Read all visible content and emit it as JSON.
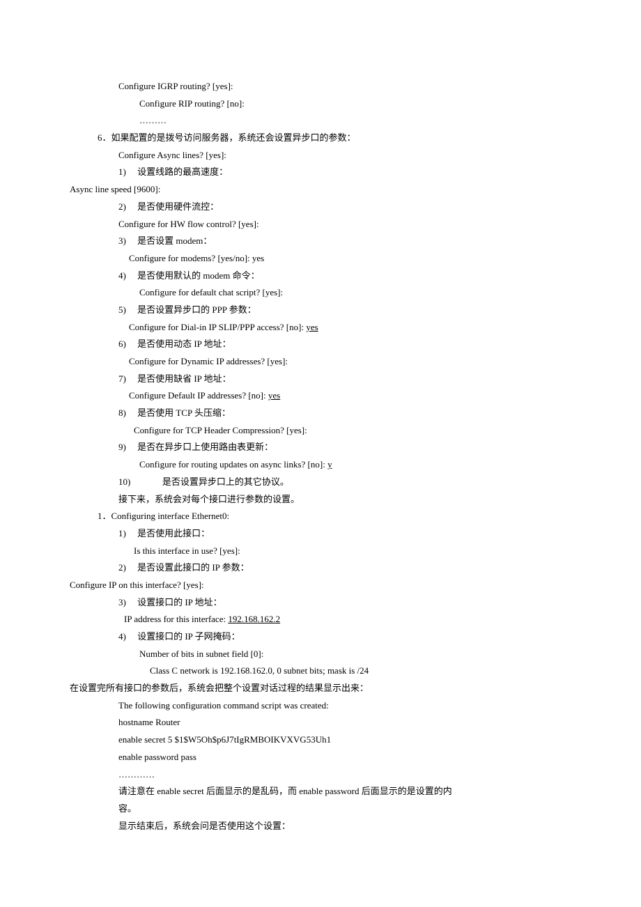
{
  "lines": [
    {
      "indent": 70,
      "text": "Configure IGRP routing? [yes]:"
    },
    {
      "indent": 100,
      "text": "Configure RIP routing? [no]:"
    },
    {
      "indent": 100,
      "text": "………"
    },
    {
      "indent": 40,
      "text": "6．如果配置的是拨号访问服务器，系统还会设置异步口的参数："
    },
    {
      "indent": 70,
      "text": "Configure Async lines? [yes]:"
    },
    {
      "indent": 70,
      "parts": [
        {
          "t": "1)"
        },
        {
          "pad": "     "
        },
        {
          "t": "设置线路的最高速度："
        }
      ]
    },
    {
      "indent": -70,
      "text": "Async line speed [9600]:"
    },
    {
      "indent": 70,
      "parts": [
        {
          "t": "2)"
        },
        {
          "pad": "     "
        },
        {
          "t": "是否使用硬件流控："
        }
      ]
    },
    {
      "indent": 70,
      "text": "Configure for HW flow control? [yes]:"
    },
    {
      "indent": 70,
      "parts": [
        {
          "t": "3)"
        },
        {
          "pad": "     "
        },
        {
          "t": "是否设置 modem："
        }
      ]
    },
    {
      "indent": 85,
      "text": "Configure for modems? [yes/no]: yes"
    },
    {
      "indent": 70,
      "parts": [
        {
          "t": "4)"
        },
        {
          "pad": "     "
        },
        {
          "t": "是否使用默认的 modem 命令："
        }
      ]
    },
    {
      "indent": 100,
      "text": "Configure for default chat script? [yes]:"
    },
    {
      "indent": 70,
      "parts": [
        {
          "t": "5)"
        },
        {
          "pad": "     "
        },
        {
          "t": "是否设置异步口的 PPP 参数："
        }
      ]
    },
    {
      "indent": 85,
      "parts": [
        {
          "t": "Configure for Dial-in IP SLIP/PPP access? [no]: "
        },
        {
          "t": "yes",
          "u": true
        }
      ]
    },
    {
      "indent": 70,
      "parts": [
        {
          "t": "6)"
        },
        {
          "pad": "     "
        },
        {
          "t": "是否使用动态 IP 地址："
        }
      ]
    },
    {
      "indent": 85,
      "text": "Configure for Dynamic IP addresses? [yes]:"
    },
    {
      "indent": 70,
      "parts": [
        {
          "t": "7)"
        },
        {
          "pad": "     "
        },
        {
          "t": "是否使用缺省 IP 地址："
        }
      ]
    },
    {
      "indent": 85,
      "parts": [
        {
          "t": "Configure Default IP addresses? [no]: "
        },
        {
          "t": "yes",
          "u": true
        }
      ]
    },
    {
      "indent": 70,
      "parts": [
        {
          "t": "8)"
        },
        {
          "pad": "     "
        },
        {
          "t": "是否使用 TCP 头压缩："
        }
      ]
    },
    {
      "indent": 92,
      "text": "Configure for TCP Header Compression? [yes]:"
    },
    {
      "indent": 70,
      "parts": [
        {
          "t": "9)"
        },
        {
          "pad": "     "
        },
        {
          "t": "是否在异步口上使用路由表更新："
        }
      ]
    },
    {
      "indent": 100,
      "parts": [
        {
          "t": "Configure for routing updates on async links? [no]: "
        },
        {
          "t": "y",
          "u": true
        }
      ]
    },
    {
      "indent": 70,
      "parts": [
        {
          "t": "10)"
        },
        {
          "pad": "              "
        },
        {
          "t": "是否设置异步口上的其它协议。"
        }
      ]
    },
    {
      "indent": 70,
      "text": "接下来，系统会对每个接口进行参数的设置。"
    },
    {
      "indent": 40,
      "text": "1．Configuring interface Ethernet0:"
    },
    {
      "indent": 70,
      "parts": [
        {
          "t": "1)"
        },
        {
          "pad": "     "
        },
        {
          "t": "是否使用此接口："
        }
      ]
    },
    {
      "indent": 92,
      "text": "Is this interface in use? [yes]:"
    },
    {
      "indent": 70,
      "parts": [
        {
          "t": "2)"
        },
        {
          "pad": "     "
        },
        {
          "t": "是否设置此接口的 IP 参数："
        }
      ]
    },
    {
      "indent": -38,
      "text": "Configure IP on this interface? [yes]:"
    },
    {
      "indent": 70,
      "parts": [
        {
          "t": "3)"
        },
        {
          "pad": "     "
        },
        {
          "t": "设置接口的 IP 地址："
        }
      ]
    },
    {
      "indent": 78,
      "parts": [
        {
          "t": "IP address for this interface: "
        },
        {
          "t": "192.168.162.2",
          "u": true
        }
      ]
    },
    {
      "indent": 70,
      "parts": [
        {
          "t": "4)"
        },
        {
          "pad": "     "
        },
        {
          "t": "设置接口的 IP 子网掩码："
        }
      ]
    },
    {
      "indent": 100,
      "text": "Number of bits in subnet field [0]:"
    },
    {
      "indent": 115,
      "text": "Class C network is 192.168.162.0, 0 subnet bits; mask is /24"
    },
    {
      "indent": -38,
      "text": "在设置完所有接口的参数后，系统会把整个设置对话过程的结果显示出来："
    },
    {
      "indent": 70,
      "text": "The following configuration command script was created:"
    },
    {
      "indent": 70,
      "text": "hostname Router"
    },
    {
      "indent": 70,
      "text": "enable secret 5 $1$W5Oh$p6J7tIgRMBOIKVXVG53Uh1"
    },
    {
      "indent": 70,
      "text": "enable password pass"
    },
    {
      "indent": 70,
      "text": "…………"
    },
    {
      "indent": 70,
      "text": "请注意在 enable secret 后面显示的是乱码，而 enable password 后面显示的是设置的内"
    },
    {
      "indent": 70,
      "text": "容。"
    },
    {
      "indent": 70,
      "text": "显示结束后，系统会问是否使用这个设置："
    }
  ]
}
